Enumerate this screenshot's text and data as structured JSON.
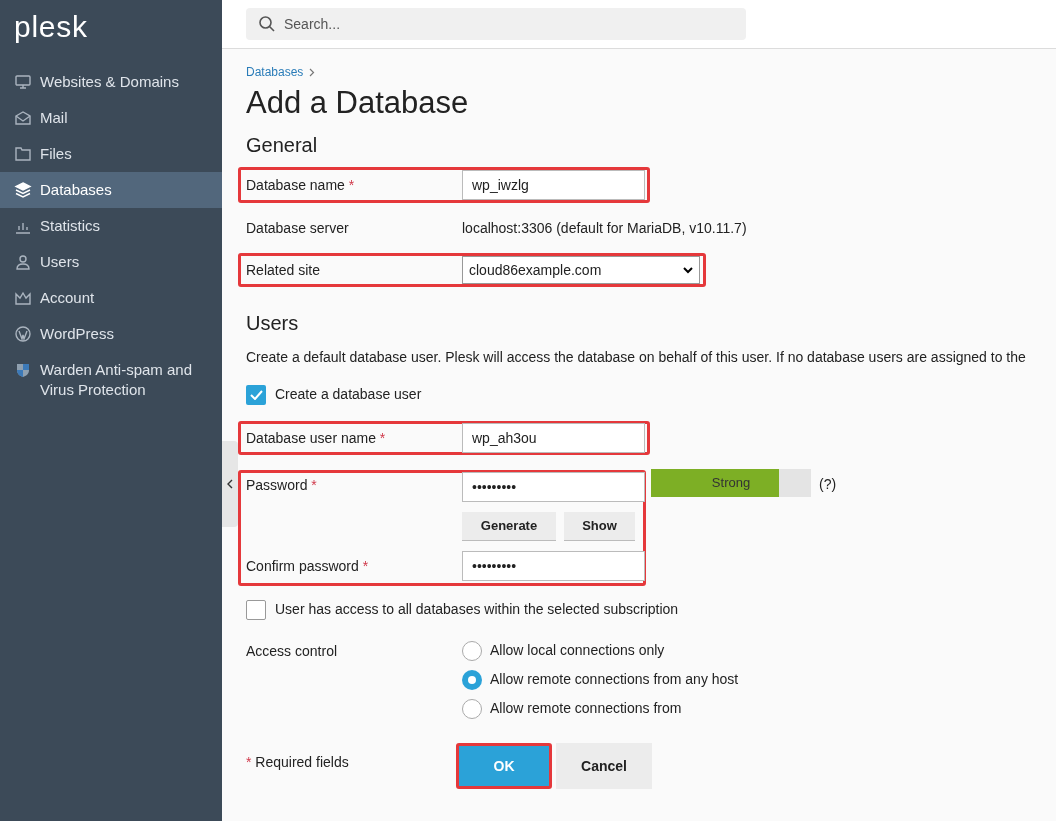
{
  "sidebar": {
    "logo": "plesk",
    "items": [
      {
        "label": "Websites & Domains",
        "kind": "monitor",
        "selected": false
      },
      {
        "label": "Mail",
        "kind": "envelope",
        "selected": false
      },
      {
        "label": "Files",
        "kind": "folder",
        "selected": false
      },
      {
        "label": "Databases",
        "kind": "layers",
        "selected": true
      },
      {
        "label": "Statistics",
        "kind": "chart",
        "selected": false
      },
      {
        "label": "Users",
        "kind": "person",
        "selected": false
      },
      {
        "label": "Account",
        "kind": "crown",
        "selected": false
      },
      {
        "label": "WordPress",
        "kind": "wordpress",
        "selected": false
      },
      {
        "label": "Warden Anti-spam and Virus Protection",
        "kind": "shield",
        "selected": false
      }
    ]
  },
  "search": {
    "placeholder": "Search..."
  },
  "breadcrumb": [
    "Databases"
  ],
  "title": "Add a Database",
  "general": {
    "heading": "General",
    "fields": [
      {
        "kind": "text",
        "label": "Database name",
        "required_mark": "*",
        "value": "wp_iwzlg",
        "highlighted": true
      },
      {
        "kind": "static",
        "label": "Database server",
        "value": "localhost:3306 (default for MariaDB, v10.11.7)"
      },
      {
        "kind": "select",
        "label": "Related site",
        "value": "cloud86example.com",
        "highlighted": true
      }
    ]
  },
  "users": {
    "heading": "Users",
    "description": "Create a default database user. Plesk will access the database on behalf of this user. If no database users are assigned to the",
    "create_user": {
      "label": "Create a database user",
      "checked": true
    },
    "user_name": {
      "label": "Database user name",
      "required_mark": "*",
      "value": "wp_ah3ou",
      "highlighted": true
    },
    "password_group": {
      "highlighted": true,
      "password": {
        "label": "Password",
        "required_mark": "*",
        "value": "•••••••••"
      },
      "strength": {
        "label": "Strong",
        "level": 0.8
      },
      "help": "(?)",
      "buttons": [
        "Generate",
        "Show"
      ],
      "confirm": {
        "label": "Confirm password",
        "required_mark": "*",
        "value": "•••••••••"
      }
    },
    "all_databases": {
      "label": "User has access to all databases within the selected subscription",
      "checked": false
    },
    "access": {
      "label": "Access control",
      "options": [
        {
          "label": "Allow local connections only",
          "selected": false
        },
        {
          "label": "Allow remote connections from any host",
          "selected": true
        },
        {
          "label": "Allow remote connections from",
          "selected": false
        }
      ]
    }
  },
  "footer": {
    "required_mark": "*",
    "note": "Required fields",
    "buttons": [
      {
        "label": "OK",
        "kind": "primary",
        "highlighted": true
      },
      {
        "label": "Cancel",
        "kind": "secondary",
        "highlighted": false
      }
    ]
  }
}
